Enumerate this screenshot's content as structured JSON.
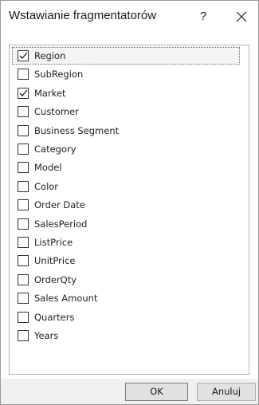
{
  "dialog": {
    "title": "Wstawianie fragmentatorów",
    "help_label": "?",
    "close_icon": "close-icon"
  },
  "fields": [
    {
      "label": "Region",
      "checked": true
    },
    {
      "label": "SubRegion",
      "checked": false
    },
    {
      "label": "Market",
      "checked": true
    },
    {
      "label": "Customer",
      "checked": false
    },
    {
      "label": "Business Segment",
      "checked": false
    },
    {
      "label": "Category",
      "checked": false
    },
    {
      "label": "Model",
      "checked": false
    },
    {
      "label": "Color",
      "checked": false
    },
    {
      "label": "Order Date",
      "checked": false
    },
    {
      "label": "SalesPeriod",
      "checked": false
    },
    {
      "label": "ListPrice",
      "checked": false
    },
    {
      "label": "UnitPrice",
      "checked": false
    },
    {
      "label": "OrderQty",
      "checked": false
    },
    {
      "label": "Sales Amount",
      "checked": false
    },
    {
      "label": "Quarters",
      "checked": false
    },
    {
      "label": "Years",
      "checked": false
    }
  ],
  "footer": {
    "ok_label": "OK",
    "cancel_label": "Anuluj"
  }
}
